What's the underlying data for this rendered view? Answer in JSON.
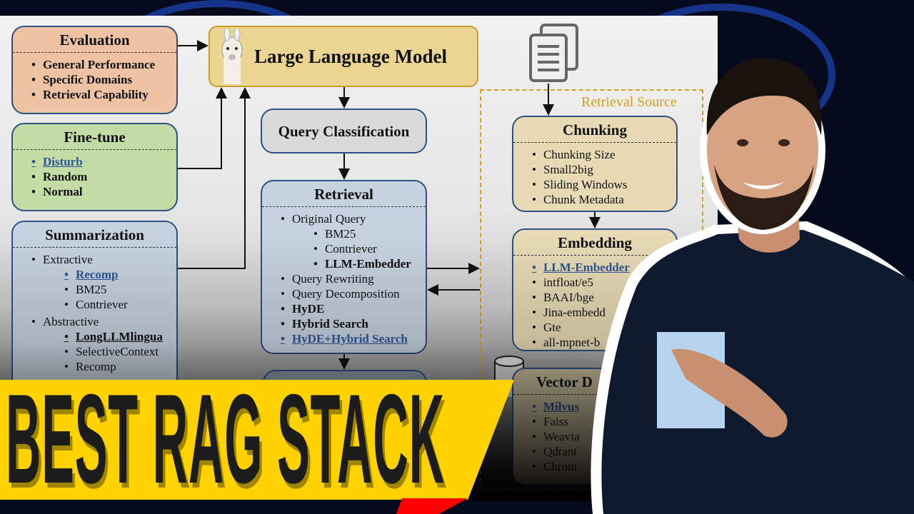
{
  "thumbnail_title": "BEST RAG STACK",
  "colors": {
    "banner": "#ffd200",
    "accent_red": "#ff0000",
    "link_blue": "#2f5597",
    "retrieval_source": "#d4a017"
  },
  "diagram": {
    "llm": {
      "title": "Large Language Model",
      "icon": "llama-icon"
    },
    "evaluation": {
      "title": "Evaluation",
      "items": [
        "General Performance",
        "Specific Domains",
        "Retrieval Capability"
      ]
    },
    "finetune": {
      "title": "Fine-tune",
      "items": [
        "Disturb",
        "Random",
        "Normal"
      ]
    },
    "summarization": {
      "title": "Summarization",
      "items": [
        "Extractive",
        "Recomp",
        "BM25",
        "Contriever",
        "Abstractive",
        "LongLLMlingua",
        "SelectiveContext",
        "Recomp"
      ]
    },
    "query_classification": {
      "title": "Query Classification"
    },
    "retrieval": {
      "title": "Retrieval",
      "items": [
        "Original Query",
        "BM25",
        "Contriever",
        "LLM-Embedder",
        "Query Rewriting",
        "Query Decomposition",
        "HyDE",
        "Hybrid Search",
        "HyDE+Hybrid Search"
      ]
    },
    "retrieval_source": "Retrieval Source",
    "chunking": {
      "title": "Chunking",
      "items": [
        "Chunking Size",
        "Small2big",
        "Sliding Windows",
        "Chunk Metadata"
      ]
    },
    "embedding": {
      "title": "Embedding",
      "items": [
        "LLM-Embedder",
        "intfloat/e5",
        "BAAI/bge",
        "Jina-embedd",
        "Gte",
        "all-mpnet-b"
      ]
    },
    "vector_db": {
      "title": "Vector D",
      "items": [
        "Milvus",
        "Faiss",
        "Weavia",
        "Qdrant",
        "Chrom"
      ]
    }
  }
}
